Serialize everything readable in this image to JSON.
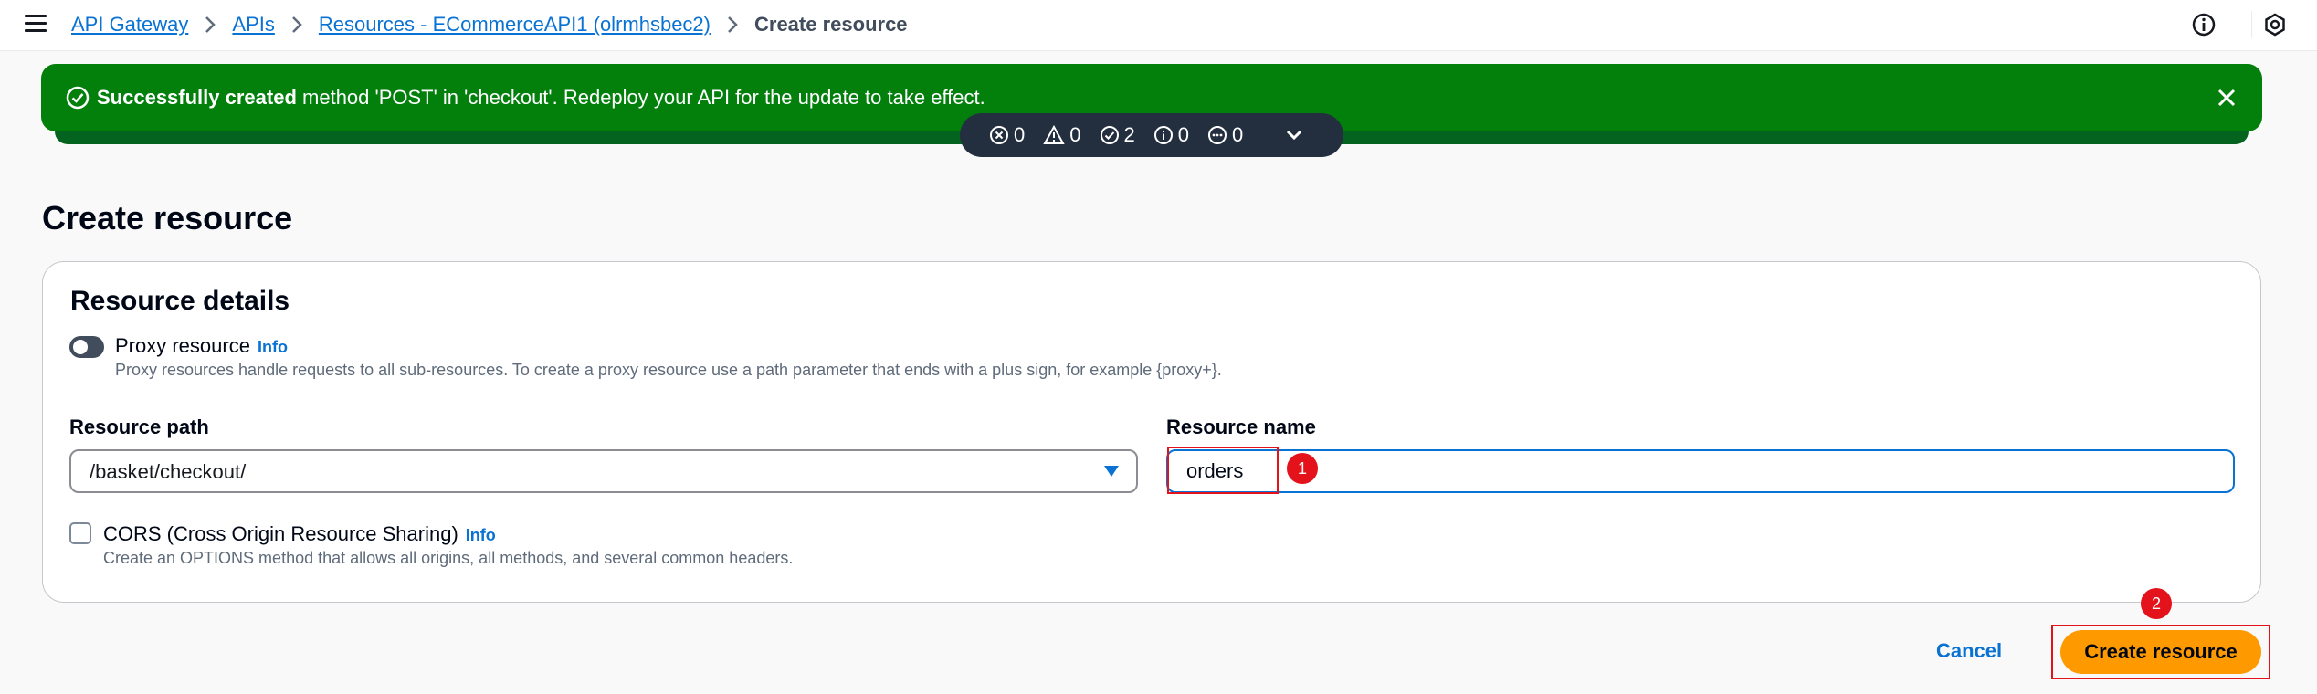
{
  "breadcrumbs": {
    "api_gateway": "API Gateway",
    "apis": "APIs",
    "resources": "Resources - ECommerceAPI1 (olrmhsbec2)",
    "current": "Create resource"
  },
  "flash": {
    "bold": "Successfully created",
    "message": " method 'POST' in 'checkout'. Redeploy your API for the update to take effect."
  },
  "notifications": {
    "errors": "0",
    "warnings": "0",
    "success": "2",
    "info": "0",
    "in_progress": "0"
  },
  "page_title": "Create resource",
  "panel": {
    "title": "Resource details",
    "proxy_label": "Proxy resource",
    "info": "Info",
    "proxy_description": "Proxy resources handle requests to all sub-resources. To create a proxy resource use a path parameter that ends with a plus sign, for example {proxy+}.",
    "resource_path_label": "Resource path",
    "resource_path_value": "/basket/checkout/",
    "resource_name_label": "Resource name",
    "resource_name_value": "orders",
    "cors_label": "CORS (Cross Origin Resource Sharing)",
    "cors_description": "Create an OPTIONS method that allows all origins, all methods, and several common headers."
  },
  "actions": {
    "cancel": "Cancel",
    "create": "Create resource"
  },
  "annotations": {
    "one": "1",
    "two": "2"
  },
  "colors": {
    "flash_green": "#037f0c",
    "link_blue": "#0972d3",
    "primary_orange": "#ff9900",
    "annotation_red": "#e3121b"
  }
}
